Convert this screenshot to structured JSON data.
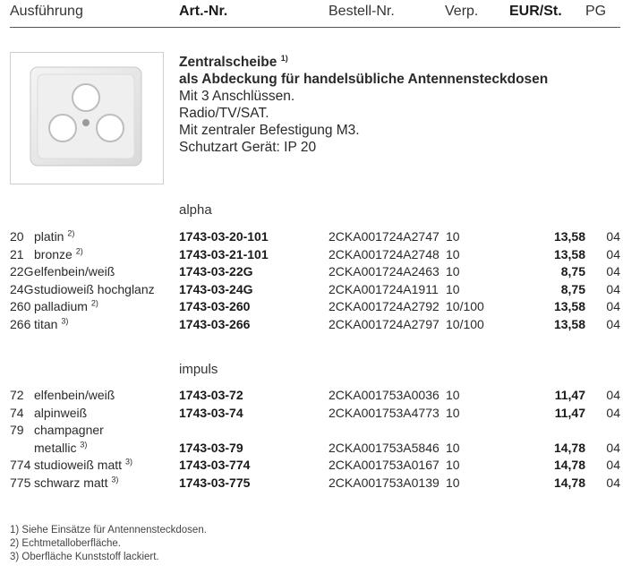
{
  "header": {
    "ausfuehrung": "Ausführung",
    "art_nr": "Art.-Nr.",
    "bestell_nr": "Bestell-Nr.",
    "verp": "Verp.",
    "eur_st": "EUR/St.",
    "pg": "PG"
  },
  "product": {
    "title": "Zentralscheibe",
    "title_sup": "1)",
    "subtitle": "als Abdeckung für handelsübliche Antennensteckdosen",
    "lines": [
      "Mit 3 Anschlüssen.",
      "Radio/TV/SAT.",
      "Mit zentraler Befestigung M3.",
      "Schutzart Gerät: IP 20"
    ]
  },
  "series_alpha": {
    "name": "alpha",
    "rows": [
      {
        "code": "20",
        "name": "platin",
        "sup": "2)",
        "art": "1743-03-20-101",
        "best": "2CKA001724A2747",
        "verp": "10",
        "price": "13,58",
        "pg": "04"
      },
      {
        "code": "21",
        "name": "bronze",
        "sup": "2)",
        "art": "1743-03-21-101",
        "best": "2CKA001724A2748",
        "verp": "10",
        "price": "13,58",
        "pg": "04"
      },
      {
        "code": "22G",
        "name": "elfenbein/weiß",
        "sup": "",
        "art": "1743-03-22G",
        "best": "2CKA001724A2463",
        "verp": "10",
        "price": "8,75",
        "pg": "04"
      },
      {
        "code": "24G",
        "name": "studioweiß hochglanz",
        "sup": "",
        "art": "1743-03-24G",
        "best": "2CKA001724A1911",
        "verp": "10",
        "price": "8,75",
        "pg": "04"
      },
      {
        "code": "260",
        "name": "palladium",
        "sup": "2)",
        "art": "1743-03-260",
        "best": "2CKA001724A2792",
        "verp": "10/100",
        "price": "13,58",
        "pg": "04"
      },
      {
        "code": "266",
        "name": "titan",
        "sup": "3)",
        "art": "1743-03-266",
        "best": "2CKA001724A2797",
        "verp": "10/100",
        "price": "13,58",
        "pg": "04"
      }
    ]
  },
  "series_impuls": {
    "name": "impuls",
    "rows": [
      {
        "code": "72",
        "name": "elfenbein/weiß",
        "sup": "",
        "art": "1743-03-72",
        "best": "2CKA001753A0036",
        "verp": "10",
        "price": "11,47",
        "pg": "04"
      },
      {
        "code": "74",
        "name": "alpinweiß",
        "sup": "",
        "art": "1743-03-74",
        "best": "2CKA001753A4773",
        "verp": "10",
        "price": "11,47",
        "pg": "04"
      },
      {
        "code": "79",
        "name": "champagner",
        "sup": "",
        "art": "",
        "best": "",
        "verp": "",
        "price": "",
        "pg": ""
      },
      {
        "code": "",
        "name": "metallic",
        "sup": "3)",
        "art": "1743-03-79",
        "best": "2CKA001753A5846",
        "verp": "10",
        "price": "14,78",
        "pg": "04"
      },
      {
        "code": "774",
        "name": "studioweiß matt",
        "sup": "3)",
        "art": "1743-03-774",
        "best": "2CKA001753A0167",
        "verp": "10",
        "price": "14,78",
        "pg": "04"
      },
      {
        "code": "775",
        "name": "schwarz matt",
        "sup": "3)",
        "art": "1743-03-775",
        "best": "2CKA001753A0139",
        "verp": "10",
        "price": "14,78",
        "pg": "04"
      }
    ]
  },
  "footnotes": [
    "1)  Siehe Einsätze für Antennensteckdosen.",
    "2)  Echtmetalloberfläche.",
    "3)  Oberfläche Kunststoff lackiert."
  ]
}
